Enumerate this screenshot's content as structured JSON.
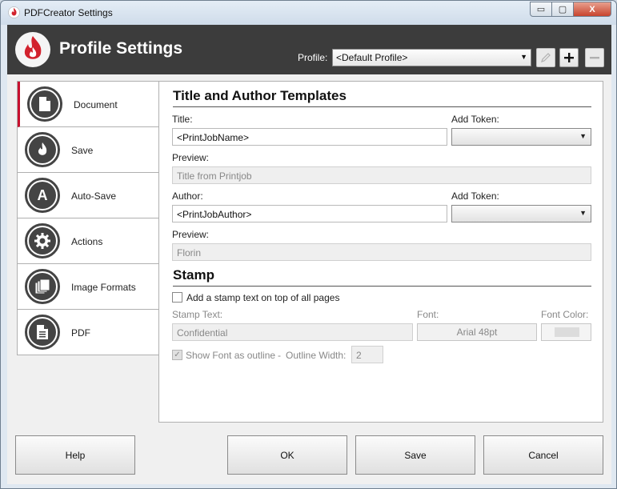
{
  "window": {
    "title": "PDFCreator Settings",
    "minimize": "▭",
    "maximize": "▢",
    "close": "X"
  },
  "header": {
    "title": "Profile Settings",
    "profile_label": "Profile:",
    "profile_value": "<Default Profile>"
  },
  "nav": {
    "items": [
      {
        "label": "Document",
        "icon": "document-icon",
        "active": true
      },
      {
        "label": "Save",
        "icon": "flame-icon"
      },
      {
        "label": "Auto-Save",
        "icon": "autosave-a-icon"
      },
      {
        "label": "Actions",
        "icon": "gear-icon"
      },
      {
        "label": "Image Formats",
        "icon": "image-stack-icon"
      },
      {
        "label": "PDF",
        "icon": "pdf-document-icon"
      }
    ]
  },
  "templates": {
    "heading": "Title and Author Templates",
    "title_label": "Title:",
    "title_value": "<PrintJobName>",
    "add_token_label": "Add Token:",
    "title_preview_label": "Preview:",
    "title_preview_value": "Title from Printjob",
    "author_label": "Author:",
    "author_value": "<PrintJobAuthor>",
    "author_add_token_label": "Add Token:",
    "author_preview_label": "Preview:",
    "author_preview_value": "Florin"
  },
  "stamp": {
    "heading": "Stamp",
    "checkbox_label": "Add a stamp text on top of all pages",
    "stamp_text_label": "Stamp Text:",
    "stamp_text_value": "Confidential",
    "font_label": "Font:",
    "font_value": "Arial 48pt",
    "font_color_label": "Font Color:",
    "outline_label": "Show Font as outline",
    "separator": "-",
    "outline_width_label": "Outline Width:",
    "outline_width_value": "2"
  },
  "buttons": {
    "help": "Help",
    "ok": "OK",
    "save": "Save",
    "cancel": "Cancel"
  },
  "colors": {
    "header_bg": "#3c3c3c",
    "accent_red": "#c8102e",
    "window_frame": "#dfe8f1"
  }
}
